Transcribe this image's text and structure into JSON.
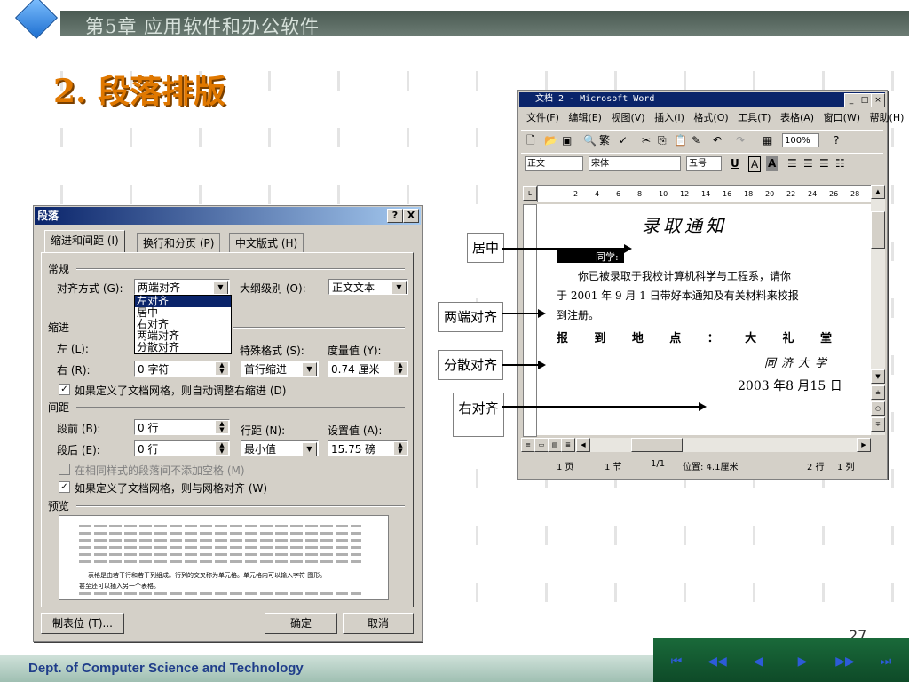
{
  "slide": {
    "chapter": "第5章  应用软件和办公软件",
    "section_title": "2. 段落排版",
    "footer": "Dept. of Computer Science and Technology",
    "page_number": "27",
    "nav": [
      "⏮",
      "◀◀",
      "◀",
      "▶",
      "▶▶",
      "⏭"
    ]
  },
  "dialog": {
    "title": "段落",
    "help_btn": "?",
    "close_btn": "X",
    "tabs": [
      "缩进和间距 (I)",
      "换行和分页 (P)",
      "中文版式 (H)"
    ],
    "general_group": "常规",
    "align_label": "对齐方式 (G):",
    "align_value": "两端对齐",
    "outline_label": "大纲级别 (O):",
    "outline_value": "正文文本",
    "align_options": [
      "左对齐",
      "居中",
      "右对齐",
      "两端对齐",
      "分散对齐"
    ],
    "indent_group": "缩进",
    "left_label": "左 (L):",
    "right_label": "右 (R):",
    "right_value": "0 字符",
    "special_label": "特殊格式 (S):",
    "special_value": "首行缩进",
    "measure_label": "度量值 (Y):",
    "measure_value": "0.74 厘米",
    "auto_indent_check": "如果定义了文档网格，则自动调整右缩进 (D)",
    "spacing_group": "间距",
    "before_label": "段前 (B):",
    "before_value": "0 行",
    "after_label": "段后 (E):",
    "after_value": "0 行",
    "line_label": "行距 (N):",
    "line_value": "最小值",
    "setval_label": "设置值 (A):",
    "setval_value": "15.75 磅",
    "same_style_check": "在相同样式的段落间不添加空格 (M)",
    "grid_check": "如果定义了文档网格，则与网格对齐 (W)",
    "preview_group": "预览",
    "preview_text_1": "表格是由若干行和若干列组成。行列的交叉称为单元格。单元格内可以输入字符  图形。",
    "preview_text_2": "甚至还可以插入另一个表格。",
    "tab_stops_btn": "制表位 (T)...",
    "ok_btn": "确定",
    "cancel_btn": "取消"
  },
  "word": {
    "title": "文档 2 - Microsoft Word",
    "menus": [
      "文件(F)",
      "编辑(E)",
      "视图(V)",
      "插入(I)",
      "格式(O)",
      "工具(T)",
      "表格(A)",
      "窗口(W)",
      "帮助(H)"
    ],
    "zoom": "100%",
    "style": "正文",
    "font": "宋体",
    "size": "五号",
    "ruler_ticks": [
      "2",
      "4",
      "6",
      "8",
      "10",
      "12",
      "14",
      "16",
      "18",
      "20",
      "22",
      "24",
      "26",
      "28"
    ],
    "doc_title": "录取通知",
    "salutation": "同学:",
    "body_1": "你已被录取于我校计算机科学与工程系，请你",
    "body_2": "于 2001 年 9 月 1 日带好本通知及有关材料来校报",
    "body_3": "到注册。",
    "address": [
      "报",
      "到",
      "地",
      "点",
      "：",
      "大",
      "礼",
      "堂"
    ],
    "signature": "同济大学",
    "date": "2003 年8 月15 日",
    "status": {
      "page": "1 页",
      "section": "1 节",
      "pages": "1/1",
      "position": "位置: 4.1厘米",
      "line": "2 行",
      "col": "1 列"
    }
  },
  "callouts": {
    "center": "居中",
    "justify": "两端对齐",
    "distributed": "分散对齐",
    "right": "右对齐"
  }
}
